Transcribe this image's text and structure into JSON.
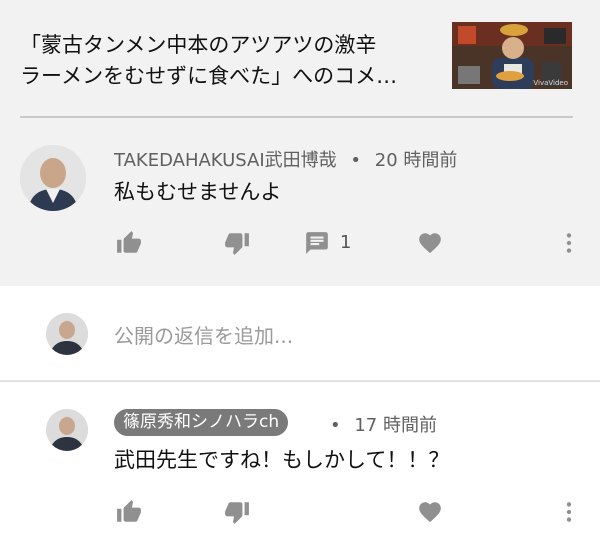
{
  "video": {
    "title_line1": "「蒙古タンメン中本のアツアツの激辛",
    "title_line2": "ラーメンをむせずに食べた」へのコメ…",
    "thumbnail_caption": "VivaVideo"
  },
  "comment": {
    "author": "TAKEDAHAKUSAI武田博哉",
    "separator": "•",
    "time": "20 時間前",
    "text": "私もむせませんよ",
    "reply_count": "1"
  },
  "reply_input": {
    "placeholder": "公開の返信を追加..."
  },
  "reply": {
    "author": "篠原秀和シノハラch",
    "separator": "•",
    "time": "17 時間前",
    "text": "武田先生ですね！もしかして！！？"
  },
  "colors": {
    "header_bg": "#f2f2f2",
    "icon": "#909090",
    "chip_bg": "#7a7a7a"
  }
}
